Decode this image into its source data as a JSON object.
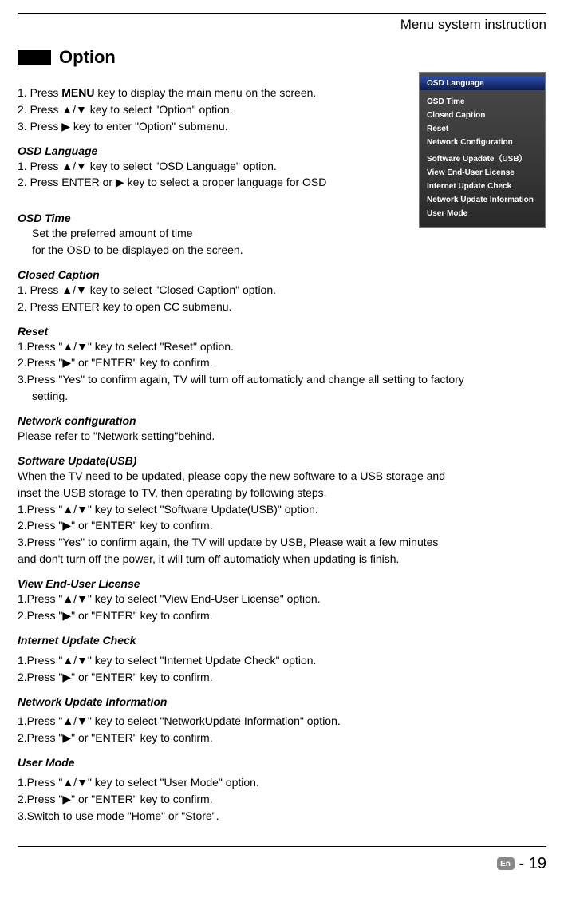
{
  "header": {
    "title": "Menu system instruction"
  },
  "section": {
    "title": "Option"
  },
  "intro": {
    "l1a": "1. Press ",
    "l1b": "MENU",
    "l1c": " key to display the main menu on the screen.",
    "l2": "2. Press ▲/▼ key to select \"Option\" option.",
    "l3": "3. Press ▶ key to enter \"Option\" submenu."
  },
  "osd_language": {
    "title": "OSD Language",
    "l1": "1. Press ▲/▼ key to select \"OSD Language\" option.",
    "l2": "2. Press ENTER  or ▶ key to select a proper language for OSD"
  },
  "osd_time": {
    "title": "OSD Time",
    "l1": "Set the preferred amount of time",
    "l2": "for the OSD to be displayed on the screen."
  },
  "closed_caption": {
    "title": "Closed Caption",
    "l1": "1. Press ▲/▼ key to select \"Closed Caption\" option.",
    "l2": "2. Press  ENTER  key  to  open  CC  submenu."
  },
  "reset": {
    "title": "Reset",
    "l1": "1.Press \"▲/▼\" key to select \"Reset\" option.",
    "l2": "2.Press \"▶\" or \"ENTER\" key to confirm.",
    "l3a": "3.Press \"Yes\" to confirm again, TV will turn off automaticly and change all setting to factory",
    "l3b": "setting."
  },
  "network_config": {
    "title": "Network configuration",
    "l1": "Please refer to \"Network setting\"behind."
  },
  "software_update": {
    "title": "Software Update(USB)",
    "l1": "When the TV need to be updated, please copy the new software to a USB storage and",
    "l2": "inset the USB storage to TV, then operating by following steps.",
    "l3": "1.Press \"▲/▼\" key to select \"Software Update(USB)\" option.",
    "l4": "2.Press \"▶\" or \"ENTER\" key to confirm.",
    "l5": "3.Press \"Yes\" to confirm again, the TV will update by USB, Please wait a few minutes",
    "l6": "and don't turn off the power, it will turn off automaticly when updating is finish."
  },
  "view_license": {
    "title": "View End-User License",
    "l1": "1.Press \"▲/▼\" key to select \"View End-User License\" option.",
    "l2": "2.Press \"▶\" or \"ENTER\" key to confirm."
  },
  "internet_update": {
    "title": "Internet Update Check",
    "l1": "1.Press \"▲/▼\" key to select \"Internet Update Check\" option.",
    "l2": "2.Press \"▶\" or \"ENTER\" key to confirm."
  },
  "network_update_info": {
    "title": "Network Update Information",
    "l1": "1.Press \"▲/▼\" key to select \"NetworkUpdate Information\" option.",
    "l2": "2.Press \"▶\" or \"ENTER\" key to confirm."
  },
  "user_mode": {
    "title": "User Mode",
    "l1": "1.Press \"▲/▼\" key to select \"User Mode\" option.",
    "l2": "2.Press \"▶\" or \"ENTER\" key to confirm.",
    "l3": "3.Switch to use mode \"Home\" or \"Store\"."
  },
  "osd_panel": {
    "items": [
      "OSD Language",
      "OSD Time",
      "Closed Caption",
      "Reset",
      "Network Configuration",
      "Software Upadate（USB）",
      "View End-User License",
      "Internet Update Check",
      "Network Update Information",
      "User Mode"
    ]
  },
  "footer": {
    "lang": "En",
    "page": "- 19"
  }
}
